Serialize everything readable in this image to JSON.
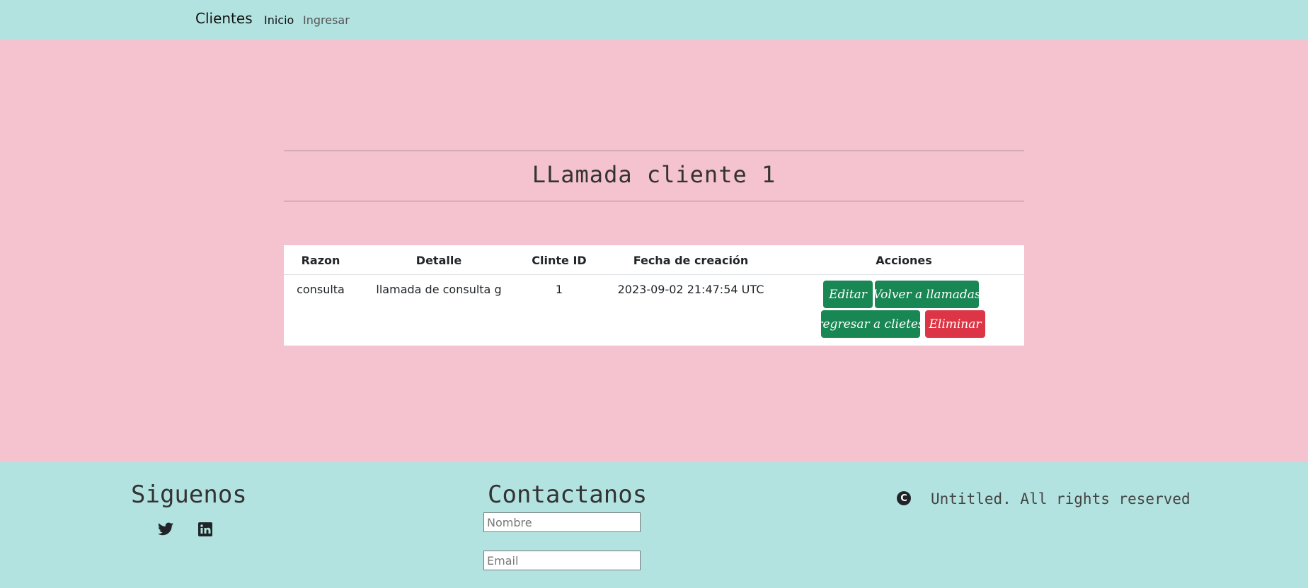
{
  "navbar": {
    "brand": "Clientes",
    "links": [
      {
        "label": "Inicio"
      },
      {
        "label": "Ingresar"
      }
    ]
  },
  "main": {
    "title": "LLamada cliente 1",
    "table": {
      "headers": [
        "Razon",
        "Detalle",
        "Clinte ID",
        "Fecha de creación",
        "Acciones"
      ],
      "rows": [
        {
          "razon": "consulta",
          "detalle": "llamada de consulta g",
          "cliente_id": "1",
          "fecha": "2023-09-02 21:47:54 UTC"
        }
      ],
      "actions": {
        "editar": "Editar",
        "volver": "Volver a llamadas",
        "regresar": "regresar a clietes",
        "eliminar": "Eliminar"
      }
    }
  },
  "colors": {
    "navbar_bg": "#b3e3e0",
    "page_bg": "#f5c2cf",
    "btn_green": "#198754",
    "btn_red": "#dc3545"
  },
  "footer": {
    "siguenos": "Siguenos",
    "social_icons": [
      "twitter-icon",
      "linkedin-icon"
    ],
    "contactanos": "Contactanos",
    "nombre_placeholder": "Nombre",
    "email_placeholder": "Email",
    "copyright_symbol": "C",
    "copyright_text": "Untitled. All rights reserved"
  }
}
